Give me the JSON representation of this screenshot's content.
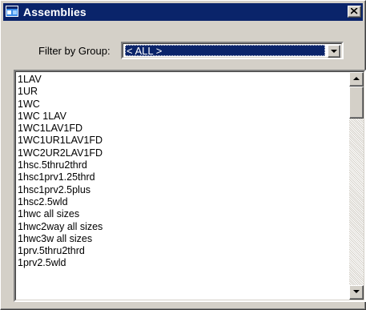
{
  "window": {
    "title": "Assemblies"
  },
  "filter": {
    "label": "Filter by Group:",
    "selected": "< ALL >"
  },
  "list": {
    "items": [
      "1LAV",
      "1UR",
      "1WC",
      "1WC 1LAV",
      "1WC1LAV1FD",
      "1WC1UR1LAV1FD",
      "1WC2UR2LAV1FD",
      "1hsc.5thru2thrd",
      "1hsc1prv1.25thrd",
      "1hsc1prv2.5plus",
      "1hsc2.5wld",
      "1hwc all sizes",
      "1hwc2way all sizes",
      "1hwc3w all sizes",
      "1prv.5thru2thrd",
      "1prv2.5wld"
    ]
  },
  "icons": {
    "app": "app-window-icon",
    "close": "close-icon",
    "dropdown": "chevron-down-icon",
    "scroll_up": "scroll-up-arrow-icon",
    "scroll_down": "scroll-down-arrow-icon"
  },
  "colors": {
    "titlebar": "#0a246a",
    "face": "#d4d0c8",
    "selection": "#0a246a"
  }
}
